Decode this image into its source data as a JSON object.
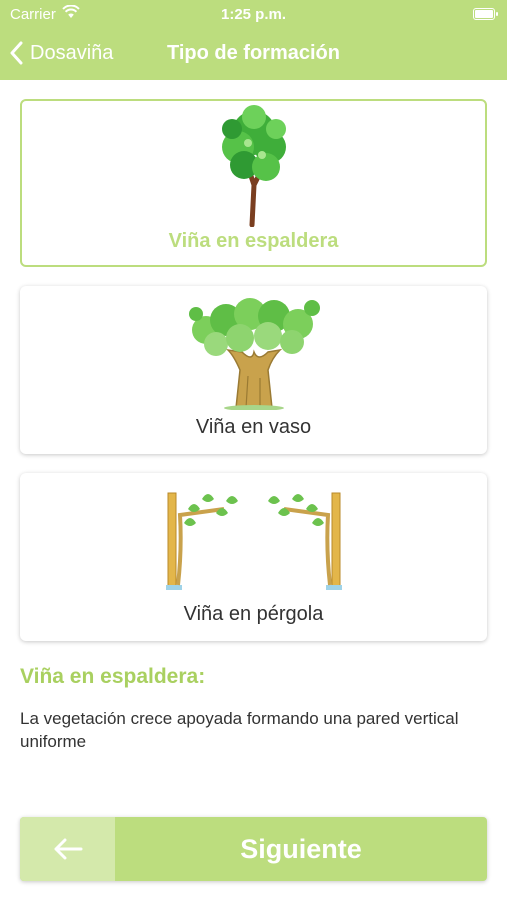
{
  "status_bar": {
    "carrier": "Carrier",
    "time": "1:25 p.m."
  },
  "nav": {
    "back_label": "Dosaviña",
    "title": "Tipo de formación"
  },
  "options": [
    {
      "label": "Viña en espaldera",
      "selected": true,
      "icon": "espaldera-vine-illustration"
    },
    {
      "label": "Viña en vaso",
      "selected": false,
      "icon": "vaso-vine-illustration"
    },
    {
      "label": "Viña en pérgola",
      "selected": false,
      "icon": "pergola-vine-illustration"
    }
  ],
  "description": {
    "title": "Viña en espaldera:",
    "text": "La vegetación crece apoyada formando una pared vertical uniforme"
  },
  "footer": {
    "back_icon": "arrow-left-icon",
    "next_label": "Siguiente"
  },
  "colors": {
    "accent": "#bcdd7e",
    "accent_light": "#d4e9ab",
    "accent_text": "#a9d060"
  }
}
